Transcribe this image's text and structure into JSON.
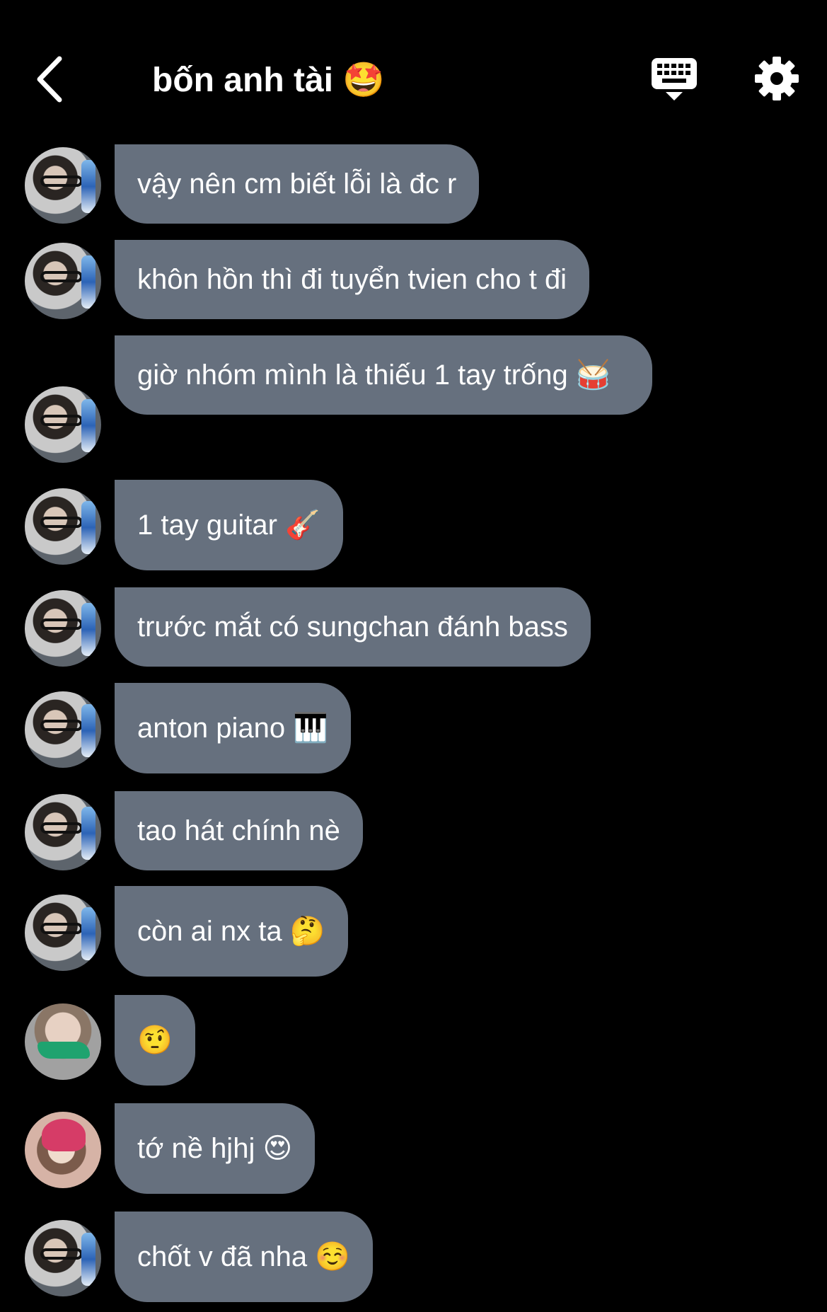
{
  "header": {
    "title": "bốn anh tài 🤩",
    "back_icon": "chevron-left-icon",
    "keyboard_icon": "keyboard-icon",
    "settings_icon": "gear-icon"
  },
  "messages": [
    {
      "text": "vậy nên cm biết lỗi là đc r"
    },
    {
      "text": "khôn hồn thì đi tuyển tvien cho t đi"
    },
    {
      "text": "giờ nhóm mình là thiếu 1 tay trống 🥁"
    },
    {
      "text": "1 tay guitar 🎸"
    },
    {
      "text": "trước mắt có sungchan đánh bass"
    },
    {
      "text": "anton piano 🎹"
    },
    {
      "text": "tao hát chính nè"
    },
    {
      "text": "còn ai nx ta 🤔"
    },
    {
      "text": "🤨"
    },
    {
      "text": "tớ nề hjhj 😍"
    },
    {
      "text": "chốt v đã nha ☺️"
    }
  ],
  "colors": {
    "background": "#000000",
    "bubble": "#66707e",
    "text": "#ffffff"
  }
}
